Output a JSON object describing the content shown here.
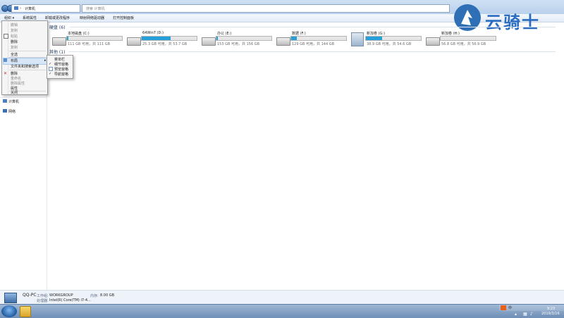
{
  "window": {
    "address": "计算机",
    "search_placeholder": "搜索 计算机"
  },
  "toolbar": {
    "items": [
      "组织 ▾",
      "系统属性",
      "卸载或更改程序",
      "映射网络驱动器",
      "打开控制面板"
    ]
  },
  "watermark": {
    "text": "云骑士"
  },
  "menu": {
    "items": [
      {
        "label": "撤销",
        "enabled": false
      },
      {
        "label": "复制",
        "enabled": false
      },
      {
        "label": "粘贴",
        "enabled": false
      },
      {
        "label": "删除",
        "enabled": true
      },
      {
        "label": "复制",
        "enabled": false
      },
      {
        "label": "全选",
        "enabled": true
      },
      {
        "label": "布局",
        "enabled": true
      },
      {
        "label": "文件夹和搜索选项",
        "enabled": true
      },
      {
        "label": "删除",
        "enabled": true
      },
      {
        "label": "重命名",
        "enabled": false
      },
      {
        "label": "删除属性",
        "enabled": false
      },
      {
        "label": "属性",
        "enabled": true
      },
      {
        "label": "关闭",
        "enabled": true
      }
    ]
  },
  "submenu": {
    "items": [
      {
        "label": "菜单栏",
        "checked": false
      },
      {
        "label": "细节窗格",
        "checked": true
      },
      {
        "label": "预览窗格",
        "checked": false
      },
      {
        "label": "导航窗格",
        "checked": true
      }
    ]
  },
  "nav": {
    "computer": "计算机",
    "network": "网络"
  },
  "content": {
    "hdd_group": "硬盘 (6)",
    "other_group": "其他 (1)",
    "drives": [
      {
        "name": "本地磁盘 (C:)",
        "size": "111 GB 可用，共 111 GB",
        "used": 0.02
      },
      {
        "name": "64Win7 (D:)",
        "size": "25.3 GB 可用，共 53.7 GB",
        "used": 0.53
      },
      {
        "name": "办公 (E:)",
        "size": "153 GB 可用，共 156 GB",
        "used": 0.02
      },
      {
        "name": "数据 (F:)",
        "size": "129 GB 可用，共 144 GB",
        "used": 0.1
      },
      {
        "name": "新加卷 (G:)",
        "size": "38.9 GB 可用，共 54.6 GB",
        "used": 0.29
      },
      {
        "name": "新加卷 (H:)",
        "size": "56.8 GB 可用，共 56.9 GB",
        "used": 0.0
      }
    ]
  },
  "details": {
    "pc_name": "QQ-PC",
    "workgroup_label": "工作组:",
    "workgroup": "WORKGROUP",
    "memory_label": "内存:",
    "memory": "8.00 GB",
    "cpu_label": "处理器:",
    "cpu": "Intel(R) Core(TM) i7-4..."
  },
  "taskbar": {
    "time": "9:23",
    "date": "2019/3/16",
    "ime": "中"
  }
}
